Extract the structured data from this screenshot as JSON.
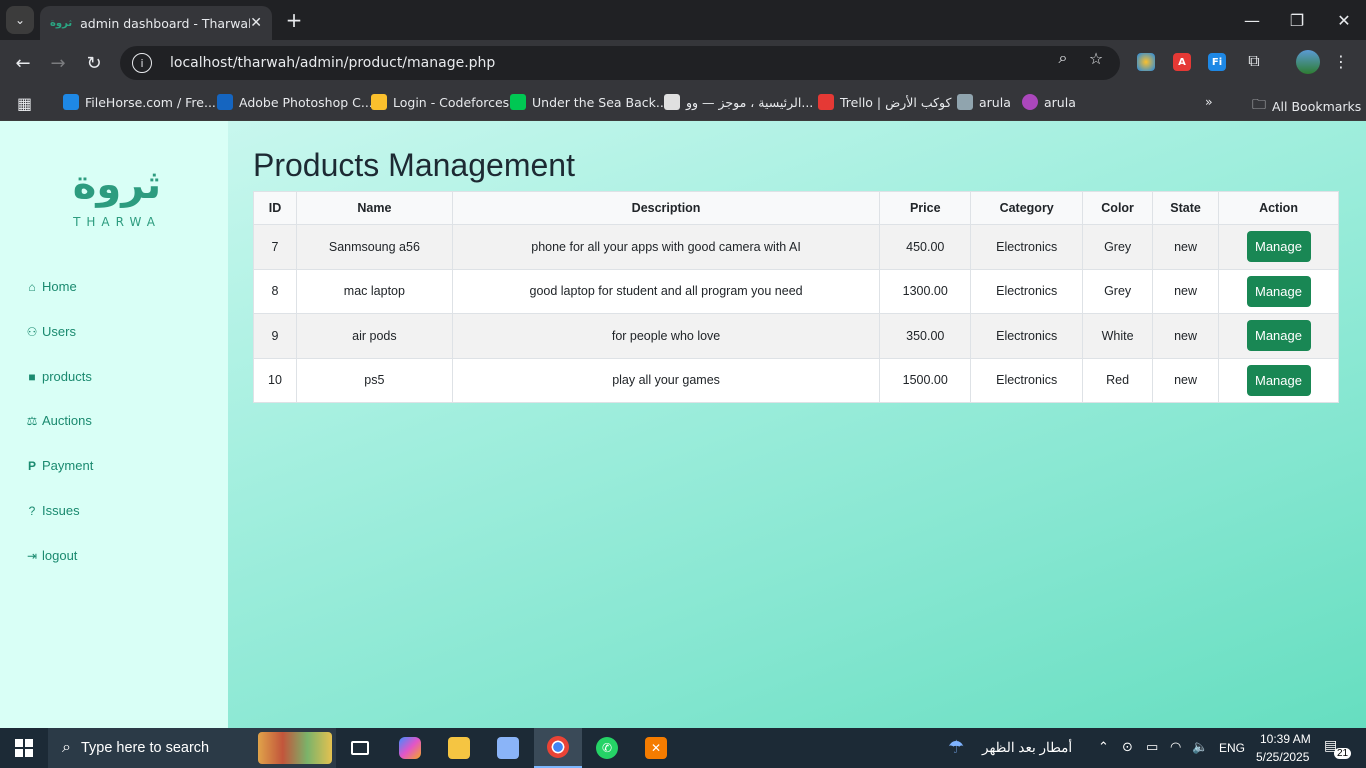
{
  "browser": {
    "tab_title": "admin dashboard - TharwahStore",
    "tab_favicon": "ثروة",
    "url": "localhost/tharwah/admin/product/manage.php",
    "bookmarks": [
      {
        "label": "FileHorse.com / Fre...",
        "color": "#1e88e5"
      },
      {
        "label": "Adobe Photoshop C...",
        "color": "#1565c0"
      },
      {
        "label": "Login - Codeforces",
        "color": "#fbc02d"
      },
      {
        "label": "Under the Sea Back...",
        "color": "#00c853"
      },
      {
        "label": "الرئيسية ، موجز — وو...",
        "color": "#e0e0e0"
      },
      {
        "label": "Trello | كوكب الأرض",
        "color": "#e53935"
      },
      {
        "label": "arula",
        "color": "#90a4ae"
      },
      {
        "label": "arula",
        "color": "#ab47bc"
      }
    ],
    "all_bookmarks": "All Bookmarks"
  },
  "sidebar": {
    "logo_arabic": "ثروة",
    "logo_text": "THARWA",
    "items": [
      {
        "label": "Home",
        "icon": "home-icon"
      },
      {
        "label": "Users",
        "icon": "users-icon"
      },
      {
        "label": "products",
        "icon": "bag-icon"
      },
      {
        "label": "Auctions",
        "icon": "gavel-icon"
      },
      {
        "label": "Payment",
        "icon": "paypal-icon"
      },
      {
        "label": "Issues",
        "icon": "question-icon"
      },
      {
        "label": "logout",
        "icon": "logout-icon"
      }
    ]
  },
  "main": {
    "title": "Products Management",
    "columns": [
      "ID",
      "Name",
      "Description",
      "Price",
      "Category",
      "Color",
      "State",
      "Action"
    ],
    "rows": [
      {
        "id": "7",
        "name": "Sanmsoung a56",
        "description": "phone for all your apps with good camera with AI",
        "price": "450.00",
        "category": "Electronics",
        "color": "Grey",
        "state": "new",
        "action": "Manage"
      },
      {
        "id": "8",
        "name": "mac laptop",
        "description": "good laptop for student and all program you need",
        "price": "1300.00",
        "category": "Electronics",
        "color": "Grey",
        "state": "new",
        "action": "Manage"
      },
      {
        "id": "9",
        "name": "air pods",
        "description": "for people who love",
        "price": "350.00",
        "category": "Electronics",
        "color": "White",
        "state": "new",
        "action": "Manage"
      },
      {
        "id": "10",
        "name": "ps5",
        "description": "play all your games",
        "price": "1500.00",
        "category": "Electronics",
        "color": "Red",
        "state": "new",
        "action": "Manage"
      }
    ]
  },
  "taskbar": {
    "search_placeholder": "Type here to search",
    "weather": "أمطار بعد الظهر",
    "language": "ENG",
    "time": "10:39 AM",
    "date": "5/25/2025",
    "notifications": "21"
  }
}
